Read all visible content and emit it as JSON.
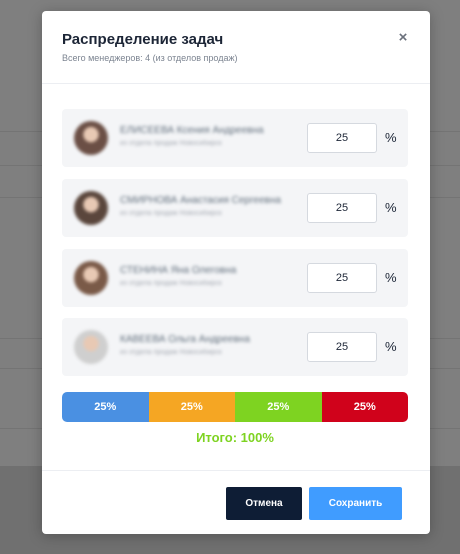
{
  "modal": {
    "title": "Распределение задач",
    "subtitle": "Всего менеджеров: 4 (из отделов продаж)",
    "close_glyph": "×"
  },
  "managers": [
    {
      "name": "ЕЛИСЕЕВА Ксения Андреевна",
      "department": "из отдела продаж Новосибирск",
      "percent": "25",
      "avatar_color": "#6b4f45"
    },
    {
      "name": "СМИРНОВА Анастасия Сергеевна",
      "department": "из отдела продаж Новосибирск",
      "percent": "25",
      "avatar_color": "#5a463c"
    },
    {
      "name": "СТЕНИНА Яна Олеговна",
      "department": "из отдела продаж Новосибирск",
      "percent": "25",
      "avatar_color": "#7a5a48"
    },
    {
      "name": "КАВЕЕВА Ольга Андреевна",
      "department": "из отдела продаж Новосибирск",
      "percent": "25",
      "avatar_color": "#cfcfcf"
    }
  ],
  "percent_sign": "%",
  "distribution": [
    {
      "label": "25%",
      "value": 25,
      "color": "#4a90e2"
    },
    {
      "label": "25%",
      "value": 25,
      "color": "#f5a623"
    },
    {
      "label": "25%",
      "value": 25,
      "color": "#7ed321"
    },
    {
      "label": "25%",
      "value": 25,
      "color": "#d0021b"
    }
  ],
  "total": {
    "text": "Итого: 100%",
    "color": "#7ed321"
  },
  "buttons": {
    "cancel": "Отмена",
    "save": "Сохранить"
  }
}
